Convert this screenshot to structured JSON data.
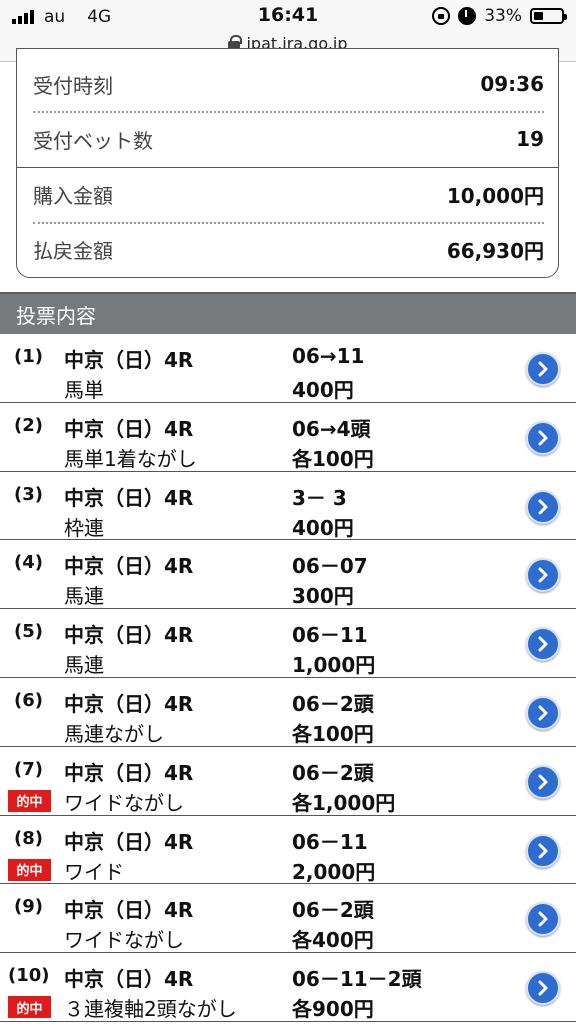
{
  "status_bar": {
    "carrier": "au",
    "network": "4G",
    "time": "16:41",
    "battery": "33%",
    "battery_level": 0.33,
    "url": "ipat.jra.go.jp"
  },
  "summary": {
    "rows": [
      {
        "label": "受付時刻",
        "value": "09:36"
      },
      {
        "label": "受付ベット数",
        "value": "19"
      },
      {
        "label": "購入金額",
        "value": "10,000円"
      },
      {
        "label": "払戻金額",
        "value": "66,930円"
      }
    ]
  },
  "section": {
    "title": "投票内容"
  },
  "hit_badge": "的中",
  "bets": [
    {
      "num": "(1)",
      "race": "中京（日）4R",
      "type": "馬単",
      "combo": "06→11",
      "amount": "400円",
      "hit": false
    },
    {
      "num": "(2)",
      "race": "中京（日）4R",
      "type": "馬単1着ながし",
      "combo": "06→4頭",
      "amount": "各100円",
      "hit": false
    },
    {
      "num": "(3)",
      "race": "中京（日）4R",
      "type": "枠連",
      "combo": "3－ 3",
      "amount": "400円",
      "hit": false
    },
    {
      "num": "(4)",
      "race": "中京（日）4R",
      "type": "馬連",
      "combo": "06－07",
      "amount": "300円",
      "hit": false
    },
    {
      "num": "(5)",
      "race": "中京（日）4R",
      "type": "馬連",
      "combo": "06－11",
      "amount": "1,000円",
      "hit": false
    },
    {
      "num": "(6)",
      "race": "中京（日）4R",
      "type": "馬連ながし",
      "combo": "06－2頭",
      "amount": "各100円",
      "hit": false
    },
    {
      "num": "(7)",
      "race": "中京（日）4R",
      "type": "ワイドながし",
      "combo": "06－2頭",
      "amount": "各1,000円",
      "hit": true
    },
    {
      "num": "(8)",
      "race": "中京（日）4R",
      "type": "ワイド",
      "combo": "06－11",
      "amount": "2,000円",
      "hit": true
    },
    {
      "num": "(9)",
      "race": "中京（日）4R",
      "type": "ワイドながし",
      "combo": "06－2頭",
      "amount": "各400円",
      "hit": false
    },
    {
      "num": "(10)",
      "race": "中京（日）4R",
      "type": "３連複軸2頭ながし",
      "combo": "06－11－2頭",
      "amount": "各900円",
      "hit": true
    }
  ],
  "colors": {
    "accent": "#2e6ccf",
    "hit": "#e01b1b",
    "header": "#777a7c"
  }
}
